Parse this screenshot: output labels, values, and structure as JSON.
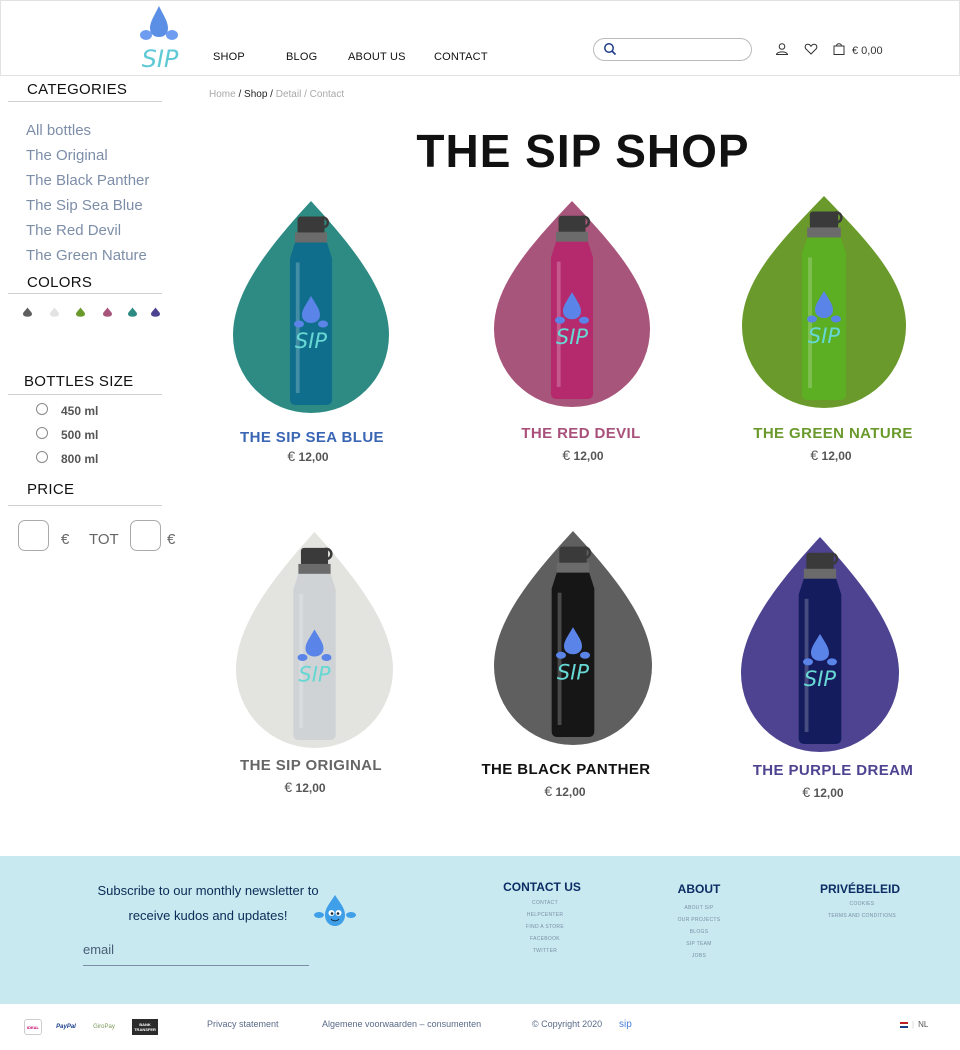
{
  "header": {
    "logo_text": "SIP",
    "nav": [
      "SHOP",
      "BLOG",
      "ABOUT US",
      "CONTACT"
    ],
    "search_placeholder": "",
    "cart_amount": "€ 0,00"
  },
  "sidebar": {
    "categories_title": "CATEGORIES",
    "categories": [
      "All bottles",
      "The Original",
      "The Black Panther",
      "The Sip Sea Blue",
      "The Red Devil",
      "The Green Nature"
    ],
    "colors_title": "COLORS",
    "colors": [
      "#5f5f5f",
      "#e3e3e3",
      "#6a9a2c",
      "#a8557b",
      "#2e8b84",
      "#4d4391"
    ],
    "sizes_title": "BOTTLES SIZE",
    "sizes": [
      "450 ml",
      "500 ml",
      "800 ml"
    ],
    "price_title": "PRICE",
    "price_currency": "€",
    "price_to": "TOT"
  },
  "breadcrumb": {
    "home": "Home",
    "sep": "/",
    "shop": "Shop",
    "detail": "Detail",
    "contact": "Contact"
  },
  "page_title": "THE SIP SHOP",
  "products": [
    {
      "name": "THE SIP SEA BLUE",
      "price": "12,00",
      "currency": "€",
      "name_color": "#3a66b4",
      "drop_color": "#2e8b84",
      "bottle_color": "#0f6e8c"
    },
    {
      "name": "THE RED DEVIL",
      "price": "12,00",
      "currency": "€",
      "name_color": "#a9507a",
      "drop_color": "#a8557b",
      "bottle_color": "#b52a6d"
    },
    {
      "name": "THE GREEN NATURE",
      "price": "12,00",
      "currency": "€",
      "name_color": "#6a9a2c",
      "drop_color": "#6a9a2c",
      "bottle_color": "#5cae22"
    },
    {
      "name": "THE SIP ORIGINAL",
      "price": "12,00",
      "currency": "€",
      "name_color": "#666666",
      "drop_color": "#e3e3df",
      "bottle_color": "#cfd3d6"
    },
    {
      "name": "THE BLACK PANTHER",
      "price": "12,00",
      "currency": "€",
      "name_color": "#111111",
      "drop_color": "#5f5f5f",
      "bottle_color": "#161616"
    },
    {
      "name": "THE PURPLE DREAM",
      "price": "12,00",
      "currency": "€",
      "name_color": "#4d4391",
      "drop_color": "#4d4391",
      "bottle_color": "#141c5e"
    }
  ],
  "footer": {
    "newsletter_text_1": "Subscribe to our monthly newsletter to",
    "newsletter_text_2": "receive kudos and updates!",
    "email_placeholder": "email",
    "contact_title": "CONTACT US",
    "contact_links": [
      "CONTACT",
      "HELPCENTER",
      "FIND A STORE",
      "FACEBOOK",
      "TWITTER"
    ],
    "about_title": "ABOUT",
    "about_links": [
      "ABOUT SIP",
      "OUR PROJECTS",
      "BLOGS",
      "SIP TEAM",
      "JOBS"
    ],
    "privacy_title": "PRIVÉBELEID",
    "privacy_links": [
      "COOKIES",
      "TERMS AND CONDITIONS"
    ]
  },
  "bottom": {
    "payments": [
      "iDEAL",
      "PayPal",
      "GiroPay",
      "BANK TRANSFER"
    ],
    "privacy": "Privacy statement",
    "terms": "Algemene voorwaarden – consumenten",
    "copyright": "© Copyright 2020",
    "brand": "sip",
    "lang": "NL"
  },
  "accent": {
    "brand_blue": "#5b8fe6",
    "brand_teal": "#4fc9d2",
    "footer_bg": "#c7e9ef"
  }
}
